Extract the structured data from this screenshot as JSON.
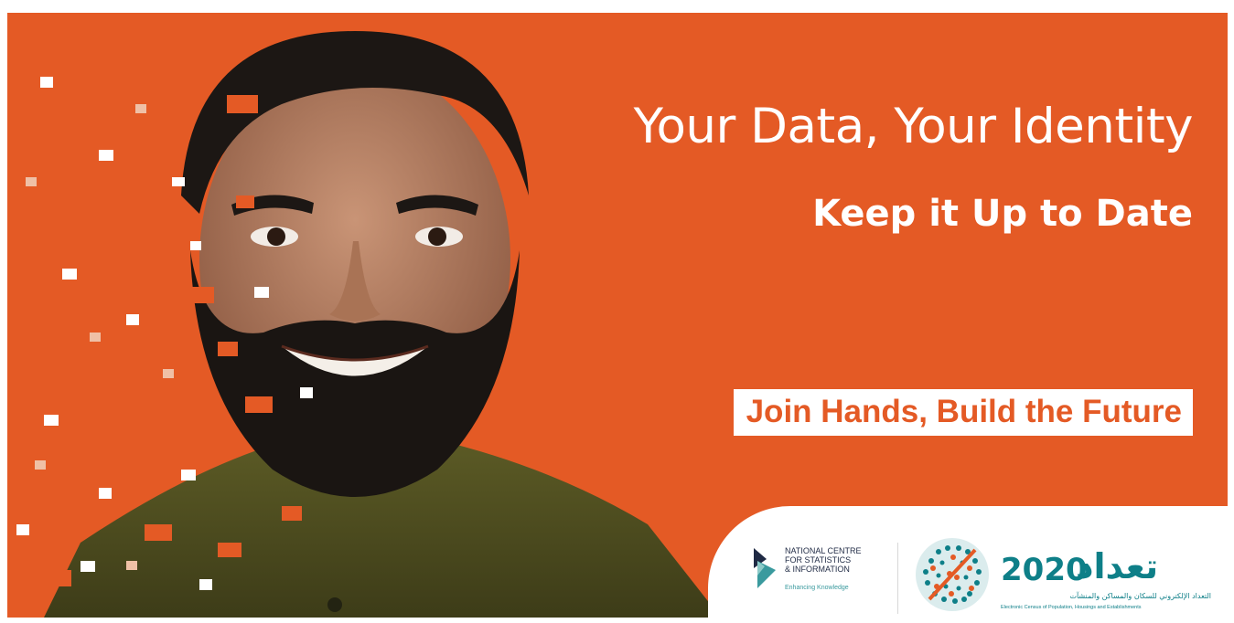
{
  "headline": "Your Data, Your Identity",
  "subheadline": "Keep it Up to Date",
  "tagline": "Join Hands, Build the Future",
  "colors": {
    "brand_orange": "#e45a25",
    "census_teal": "#0e7f88",
    "ncsi_navy": "#1f2a44"
  },
  "ncsi_logo": {
    "name_lines": [
      "NATIONAL CENTRE",
      "FOR STATISTICS",
      "& INFORMATION"
    ],
    "tagline": "Enhancing Knowledge"
  },
  "census_logo": {
    "year": "2020",
    "arabic_title": "تعداد",
    "arabic_subtitle": "التعداد الإلكتروني للسكان والمساكن والمنشآت",
    "english_subtitle": "Electronic Census of Population, Housings and Establishments"
  },
  "photo": {
    "subject": "smiling-man-pixel-dissolve"
  }
}
